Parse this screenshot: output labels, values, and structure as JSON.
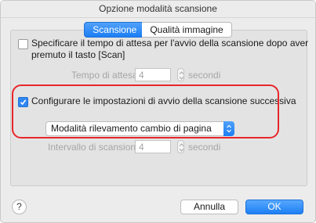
{
  "window": {
    "title": "Opzione modalità scansione"
  },
  "tabs": [
    {
      "label": "Scansione",
      "active": true
    },
    {
      "label": "Qualità immagine",
      "active": false
    }
  ],
  "wait_section": {
    "checkbox_checked": false,
    "label_line1": "Specificare il tempo di attesa per l'avvio della scansione dopo aver",
    "label_line2": "premuto il tasto [Scan]",
    "field_label": "Tempo di attesa:",
    "field_value": "4",
    "unit": "secondi"
  },
  "next_scan_section": {
    "checkbox_checked": true,
    "label": "Configurare le impostazioni di avvio della scansione successiva",
    "mode_selected": "Modalità rilevamento cambio di pagina",
    "interval_label": "Intervallo di scansione:",
    "interval_value": "4",
    "unit": "secondi"
  },
  "footer": {
    "help_label": "?",
    "cancel_label": "Annulla",
    "ok_label": "OK"
  },
  "colors": {
    "accent": "#1c7ef4",
    "highlight": "#e8262b",
    "disabled_text": "#a6a6a6"
  },
  "icons": {
    "help": "question-mark-icon",
    "checkmark": "checkmark-icon",
    "stepper": "stepper-arrows-icon",
    "popup": "chevron-up-down-icon"
  }
}
